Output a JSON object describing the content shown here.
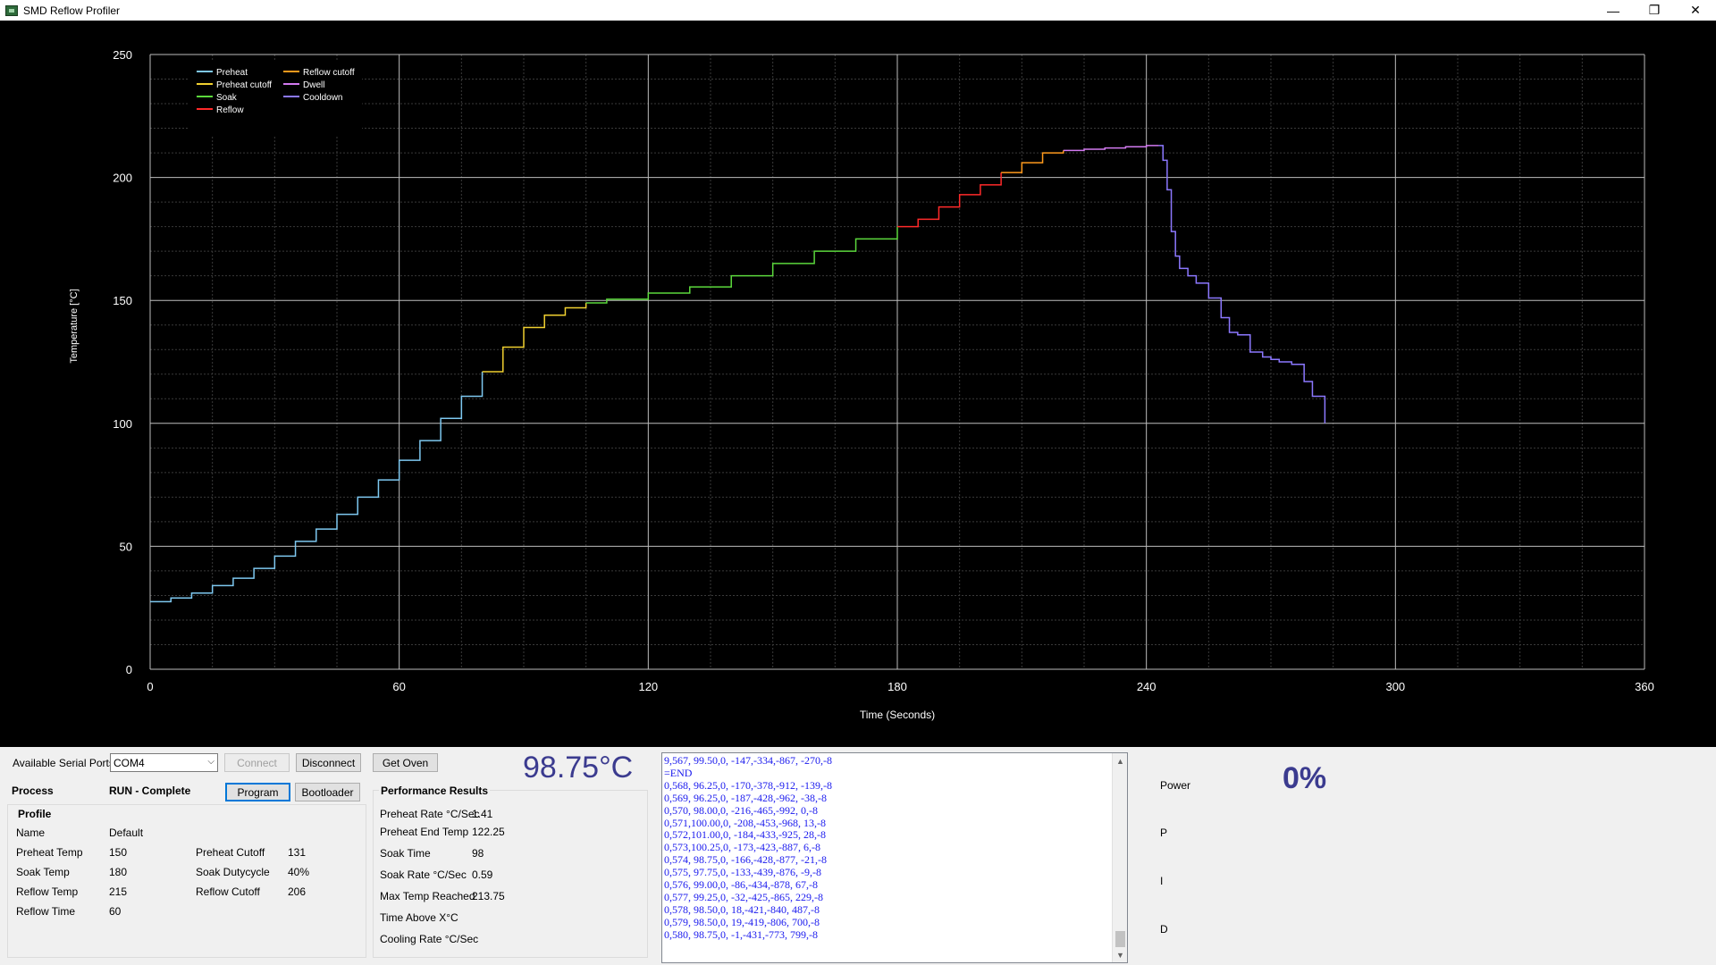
{
  "window": {
    "title": "SMD Reflow Profiler",
    "controls": [
      "—",
      "❐",
      "✕"
    ]
  },
  "chart_data": {
    "type": "line",
    "xlabel": "Time (Seconds)",
    "ylabel": "Temperature [°C]",
    "xlim": [
      0,
      360
    ],
    "ylim": [
      0,
      250
    ],
    "x_ticks": [
      "0",
      "60",
      "120",
      "180",
      "240",
      "300",
      "360"
    ],
    "y_ticks": [
      "0",
      "50",
      "100",
      "150",
      "200",
      "250"
    ],
    "grid": true,
    "legend_position": "top-left",
    "series": [
      {
        "name": "Preheat",
        "color": "#7ec8f0",
        "x": [
          0,
          5,
          10,
          15,
          20,
          25,
          30,
          35,
          40,
          45,
          50,
          55,
          60,
          65,
          70,
          75,
          80
        ],
        "y": [
          27.5,
          29,
          31,
          34,
          37,
          41,
          46,
          52,
          57,
          63,
          70,
          77,
          85,
          93,
          102,
          111,
          121
        ]
      },
      {
        "name": "Preheat cutoff",
        "color": "#f0d030",
        "x": [
          80,
          85,
          90,
          95,
          100,
          105
        ],
        "y": [
          121,
          131,
          139,
          144,
          147,
          149
        ]
      },
      {
        "name": "Soak",
        "color": "#5bd83c",
        "x": [
          105,
          110,
          120,
          130,
          140,
          150,
          160,
          170,
          180
        ],
        "y": [
          149,
          150.5,
          153,
          155.5,
          160,
          165,
          170,
          175,
          180
        ]
      },
      {
        "name": "Reflow",
        "color": "#ff2a2a",
        "x": [
          180,
          185,
          190,
          195,
          200,
          205
        ],
        "y": [
          180,
          183,
          188,
          193,
          197,
          202
        ]
      },
      {
        "name": "Reflow cutoff",
        "color": "#ff9a1c",
        "x": [
          205,
          210,
          215,
          220
        ],
        "y": [
          202,
          206,
          210,
          211
        ]
      },
      {
        "name": "Dwell",
        "color": "#d27af0",
        "x": [
          220,
          225,
          230,
          235,
          240,
          243
        ],
        "y": [
          211,
          211.5,
          212,
          212.5,
          213,
          213
        ]
      },
      {
        "name": "Cooldown",
        "color": "#8c78ff",
        "x": [
          243,
          244,
          245,
          246,
          247,
          248,
          250,
          252,
          255,
          258,
          260,
          262,
          265,
          268,
          270,
          272,
          275,
          278,
          280,
          282,
          283
        ],
        "y": [
          213,
          207,
          195,
          178,
          168,
          163,
          160,
          157,
          151,
          143,
          137,
          136,
          129,
          127,
          126,
          125,
          124,
          117,
          111,
          111,
          100
        ]
      }
    ]
  },
  "serial": {
    "label": "Available Serial Ports",
    "selected_port": "COM4",
    "connect_label": "Connect",
    "disconnect_label": "Disconnect",
    "get_oven_label": "Get Oven"
  },
  "status": {
    "current_temp": "98.75°C",
    "process_label": "Process",
    "process_value": "RUN - Complete",
    "program_label": "Program",
    "bootloader_label": "Bootloader"
  },
  "profile": {
    "group_title": "Profile",
    "name_label": "Name",
    "name_value": "Default",
    "preheat_temp_label": "Preheat Temp",
    "preheat_temp_value": "150",
    "soak_temp_label": "Soak Temp",
    "soak_temp_value": "180",
    "reflow_temp_label": "Reflow Temp",
    "reflow_temp_value": "215",
    "reflow_time_label": "Reflow Time",
    "reflow_time_value": "60",
    "preheat_cutoff_label": "Preheat Cutoff",
    "preheat_cutoff_value": "131",
    "soak_duty_label": "Soak Dutycycle",
    "soak_duty_value": "40%",
    "reflow_cutoff_label": "Reflow Cutoff",
    "reflow_cutoff_value": "206"
  },
  "performance": {
    "group_title": "Performance Results",
    "preheat_rate_label": "Preheat Rate °C/Sec",
    "preheat_rate_value": "1.41",
    "preheat_end_label": "Preheat End Temp",
    "preheat_end_value": "122.25",
    "soak_time_label": "Soak Time",
    "soak_time_value": "98",
    "soak_rate_label": "Soak Rate °C/Sec",
    "soak_rate_value": "0.59",
    "max_temp_label": "Max Temp Reached",
    "max_temp_value": "213.75",
    "time_above_label": "Time Above X°C",
    "time_above_value": "",
    "cooling_rate_label": "Cooling Rate °C/Sec",
    "cooling_rate_value": ""
  },
  "log": {
    "lines": [
      "9,567, 99.50,0, -147,-334,-867, -270,-8",
      "=END",
      "0,568, 96.25,0, -170,-378,-912, -139,-8",
      "0,569, 96.25,0, -187,-428,-962, -38,-8",
      "0,570, 98.00,0, -216,-465,-992, 0,-8",
      "0,571,100.00,0, -208,-453,-968, 13,-8",
      "0,572,101.00,0, -184,-433,-925, 28,-8",
      "0,573,100.25,0, -173,-423,-887, 6,-8",
      "0,574, 98.75,0, -166,-428,-877, -21,-8",
      "0,575, 97.75,0, -133,-439,-876, -9,-8",
      "0,576, 99.00,0, -86,-434,-878, 67,-8",
      "0,577, 99.25,0, -32,-425,-865, 229,-8",
      "0,578, 98.50,0, 18,-421,-840, 487,-8",
      "0,579, 98.50,0, 19,-419,-806, 700,-8",
      "0,580, 98.75,0, -1,-431,-773, 799,-8"
    ]
  },
  "pid": {
    "power_label": "Power",
    "power_value": "0%",
    "p_label": "P",
    "i_label": "I",
    "d_label": "D"
  }
}
